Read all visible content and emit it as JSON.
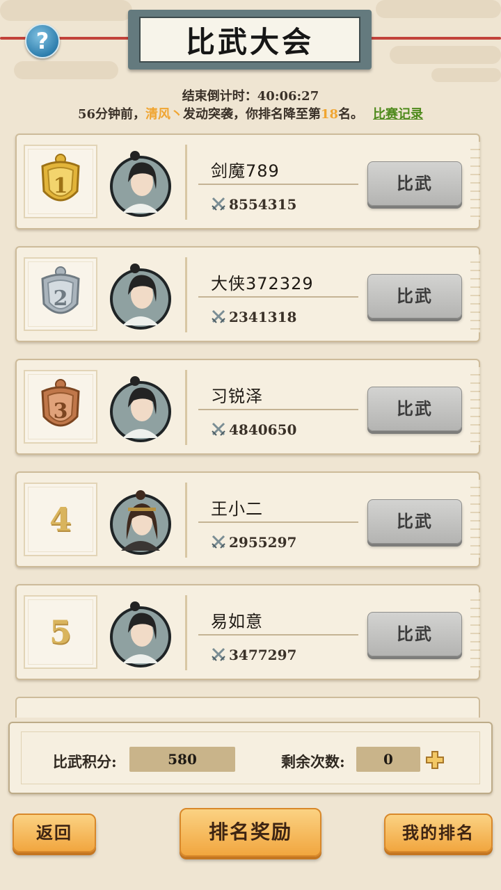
{
  "header": {
    "title": "比武大会",
    "help_icon": "?",
    "countdown": "结束倒计时：40:06:27"
  },
  "notice": {
    "prefix": "56分钟前，",
    "name": "清风丶",
    "middle": "发动突袭，你排名降至第",
    "rank": "18",
    "suffix": "名。",
    "record_link": "比赛记录"
  },
  "rankings": [
    {
      "rank": "1",
      "name": "剑魔789",
      "power": "8554315",
      "button": "比武",
      "badge": "gold-shield"
    },
    {
      "rank": "2",
      "name": "大侠372329",
      "power": "2341318",
      "button": "比武",
      "badge": "silver-shield"
    },
    {
      "rank": "3",
      "name": "习锐泽",
      "power": "4840650",
      "button": "比武",
      "badge": "bronze-shield"
    },
    {
      "rank": "4",
      "name": "王小二",
      "power": "2955297",
      "button": "比武",
      "badge": "number"
    },
    {
      "rank": "5",
      "name": "易如意",
      "power": "3477297",
      "button": "比武",
      "badge": "number"
    }
  ],
  "score": {
    "points_label": "比武积分:",
    "points_value": "580",
    "remaining_label": "剩余次数:",
    "remaining_value": "0"
  },
  "buttons": {
    "back": "返回",
    "rank_reward": "排名奖励",
    "my_rank": "我的排名"
  },
  "colors": {
    "background": "#efe5d2",
    "gold": "#e2b43a",
    "silver": "#aab4bc",
    "bronze": "#c0774a",
    "orange_button": "#f1a63f",
    "highlight": "#f0a531",
    "link_green": "#4e8a1c"
  }
}
